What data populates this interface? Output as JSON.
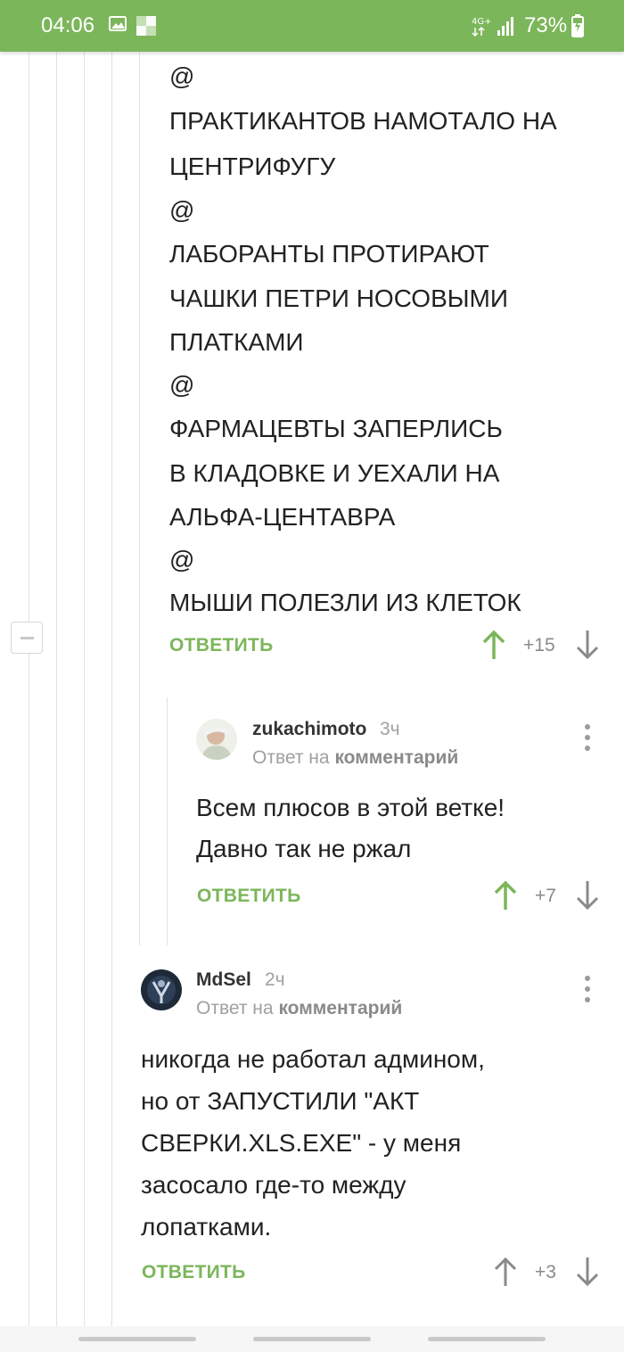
{
  "status_bar": {
    "time": "04:06",
    "network": "4G+",
    "battery": "73%",
    "icons": [
      "image-icon",
      "square-icon",
      "signal-icon",
      "battery-icon"
    ]
  },
  "parent_comment": {
    "lines": [
      "@",
      "ПРАКТИКАНТОВ НАМОТАЛО НА",
      "ЦЕНТРИФУГУ",
      "@",
      "ЛАБОРАНТЫ ПРОТИРАЮТ",
      "ЧАШКИ ПЕТРИ НОСОВЫМИ",
      "ПЛАТКАМИ",
      "@",
      "ФАРМАЦЕВТЫ ЗАПЕРЛИСЬ",
      "В КЛАДОВКЕ И УЕХАЛИ НА",
      "АЛЬФА-ЦЕНТАВРА",
      "@",
      "МЫШИ ПОЛЕЗЛИ ИЗ КЛЕТОК"
    ],
    "reply_label": "ОТВЕТИТЬ",
    "rating": "+15"
  },
  "comment_zukachimoto": {
    "username": "zukachimoto",
    "time": "3ч",
    "reply_to_prefix": "Ответ на",
    "reply_to_target": "комментарий",
    "text_lines": [
      "Всем плюсов в этой ветке!",
      "Давно так не ржал"
    ],
    "reply_label": "ОТВЕТИТЬ",
    "rating": "+7"
  },
  "comment_mdsel": {
    "username": "MdSel",
    "time": "2ч",
    "reply_to_prefix": "Ответ на",
    "reply_to_target": "комментарий",
    "text_lines": [
      "никогда не работал админом,",
      "но от ЗАПУСТИЛИ \"АКТ",
      "СВЕРКИ.XLS.EXE\" - у меня",
      "засосало где-то между",
      "лопатками."
    ],
    "reply_label": "ОТВЕТИТЬ",
    "rating": "+3"
  },
  "colors": {
    "accent": "#7cb65b",
    "upvote_active": "#7cb65b",
    "vote_neutral": "#8a8a8a"
  }
}
